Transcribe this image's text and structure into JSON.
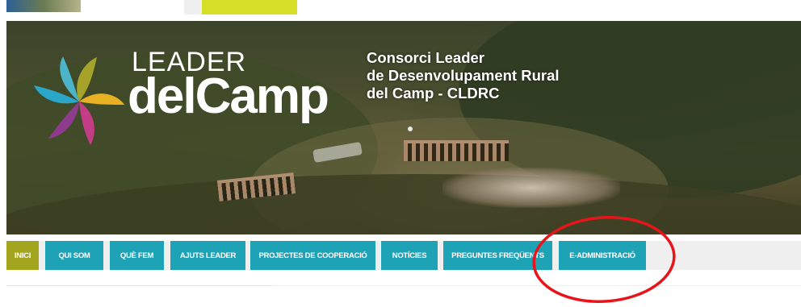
{
  "logo": {
    "line1": "LEADER",
    "line2": "delCamp"
  },
  "org_title": {
    "line1": "Consorci Leader",
    "line2": "de Desenvolupament Rural",
    "line3": "del Camp - CLDRC"
  },
  "nav": {
    "items": [
      {
        "label": "INICI",
        "active": true
      },
      {
        "label": "QUI SOM",
        "active": false
      },
      {
        "label": "QUÈ FEM",
        "active": false
      },
      {
        "label": "AJUTS LEADER",
        "active": false
      },
      {
        "label": "PROJECTES DE COOPERACIÓ",
        "active": false
      },
      {
        "label": "NOTÍCIES",
        "active": false
      },
      {
        "label": "PREGUNTES FREQÜENTS",
        "active": false
      },
      {
        "label": "E-ADMINISTRACIÓ",
        "active": false
      }
    ]
  },
  "colors": {
    "nav_item": "#1da2b6",
    "nav_active": "#a4a51f",
    "annotation_circle": "#e8141a"
  },
  "icons": {
    "logo_mark": "pinwheel-logo-icon"
  }
}
